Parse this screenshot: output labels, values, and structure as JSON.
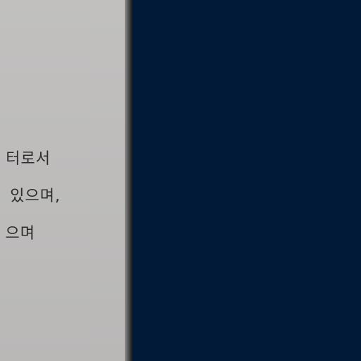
{
  "document": {
    "lines": [
      "터로서",
      "있으며,",
      "으며"
    ]
  }
}
